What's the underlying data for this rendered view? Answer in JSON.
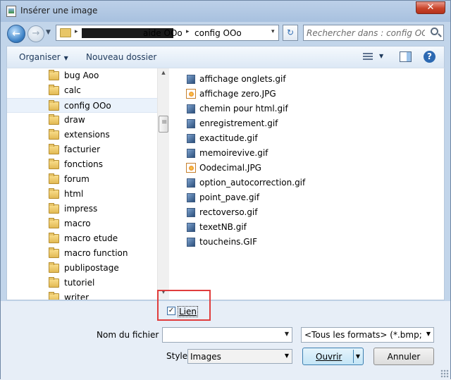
{
  "window": {
    "title": "Insérer une image",
    "close_symbol": "✕"
  },
  "address": {
    "crumbs": [
      "aide OOo",
      "config OOo"
    ],
    "separator": "▸",
    "dropdown": "▾"
  },
  "search": {
    "placeholder": "Rechercher dans : config OOo"
  },
  "toolbar": {
    "organise_label": "Organiser",
    "new_folder_label": "Nouveau dossier",
    "help_symbol": "?"
  },
  "tree": {
    "items": [
      "bug Aoo",
      "calc",
      "config OOo",
      "draw",
      "extensions",
      "facturier",
      "fonctions",
      "forum",
      "html",
      "impress",
      "macro",
      "macro etude",
      "macro function",
      "publipostage",
      "tutoriel",
      "writer"
    ],
    "selected_index": 2
  },
  "files": [
    {
      "name": "affichage onglets.gif",
      "type": "gif"
    },
    {
      "name": "affichage zero.JPG",
      "type": "jpg"
    },
    {
      "name": "chemin pour html.gif",
      "type": "gif"
    },
    {
      "name": "enregistrement.gif",
      "type": "gif"
    },
    {
      "name": "exactitude.gif",
      "type": "gif"
    },
    {
      "name": "memoirevive.gif",
      "type": "gif"
    },
    {
      "name": "Oodecimal.JPG",
      "type": "jpg"
    },
    {
      "name": "option_autocorrection.gif",
      "type": "gif"
    },
    {
      "name": "point_pave.gif",
      "type": "gif"
    },
    {
      "name": "rectoverso.gif",
      "type": "gif"
    },
    {
      "name": "texetNB.gif",
      "type": "gif"
    },
    {
      "name": "toucheins.GIF",
      "type": "gif"
    }
  ],
  "link_option": {
    "label": "Lien",
    "checked": true,
    "check_symbol": "✓"
  },
  "filename": {
    "label": "Nom du fichier :",
    "value": ""
  },
  "format": {
    "selected": "<Tous les formats> (*.bmp;*.dxf;*.emf)"
  },
  "style": {
    "label": "Style",
    "selected": "Images"
  },
  "buttons": {
    "open_label": "Ouvrir",
    "cancel_label": "Annuler"
  },
  "colors": {
    "highlight": "#e03d3d",
    "accent": "#3c7fb1"
  }
}
